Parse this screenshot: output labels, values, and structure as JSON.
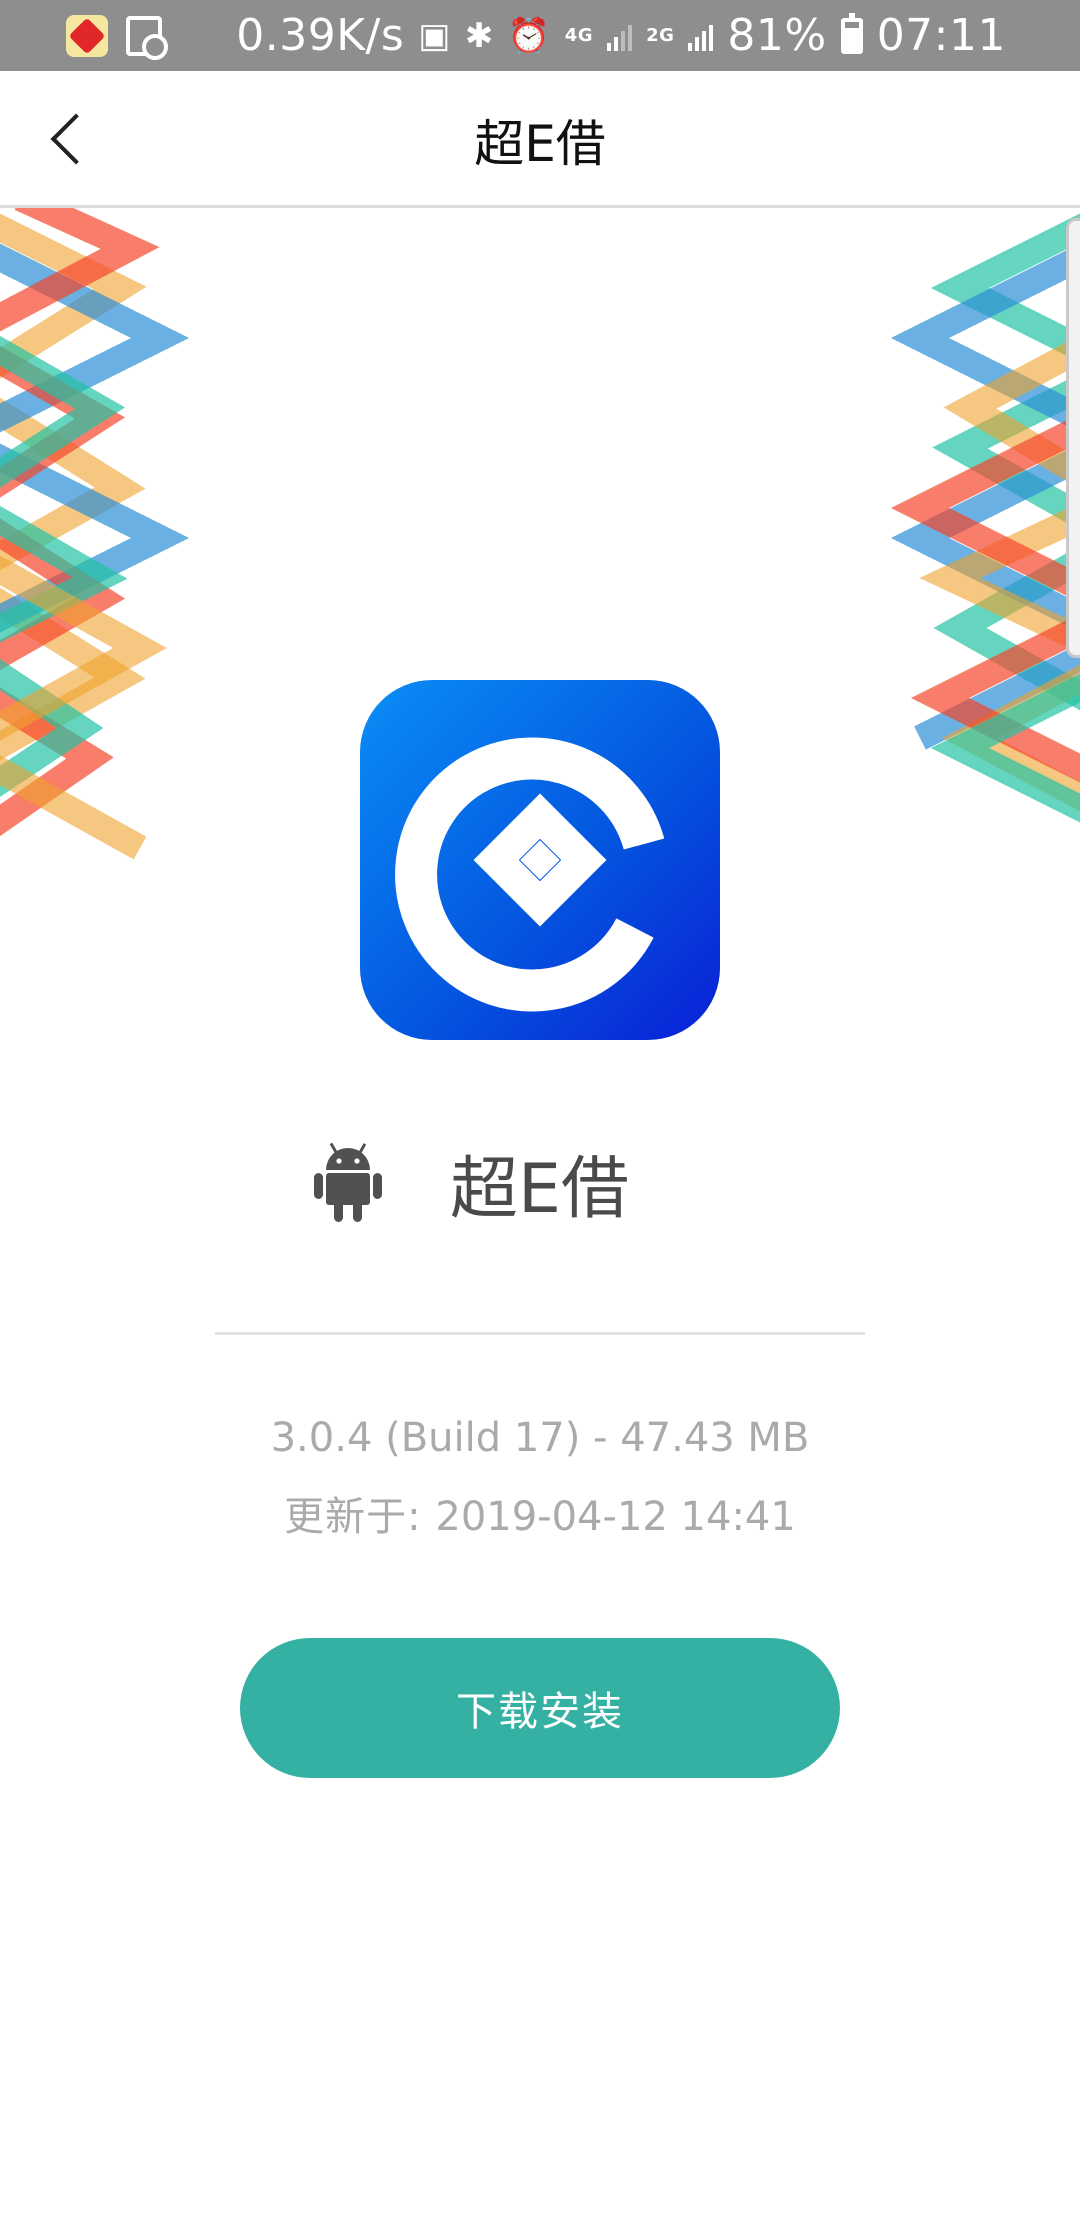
{
  "status_bar": {
    "net_speed": "0.39K/s",
    "network_4g": "4G",
    "network_2g": "2G",
    "battery_pct": "81%",
    "time": "07:11"
  },
  "nav": {
    "title": "超E借"
  },
  "app": {
    "name": "超E借",
    "version_line": "3.0.4 (Build 17) - 47.43 MB",
    "updated_label": "更新于: ",
    "updated_value": "2019-04-12 14:41"
  },
  "actions": {
    "install_label": "下载安装"
  },
  "colors": {
    "status_bar": "#8e8e8e",
    "install_button": "#34b1a3",
    "icon_gradient_start": "#0a8ef6",
    "icon_gradient_end": "#0a1fd6"
  }
}
